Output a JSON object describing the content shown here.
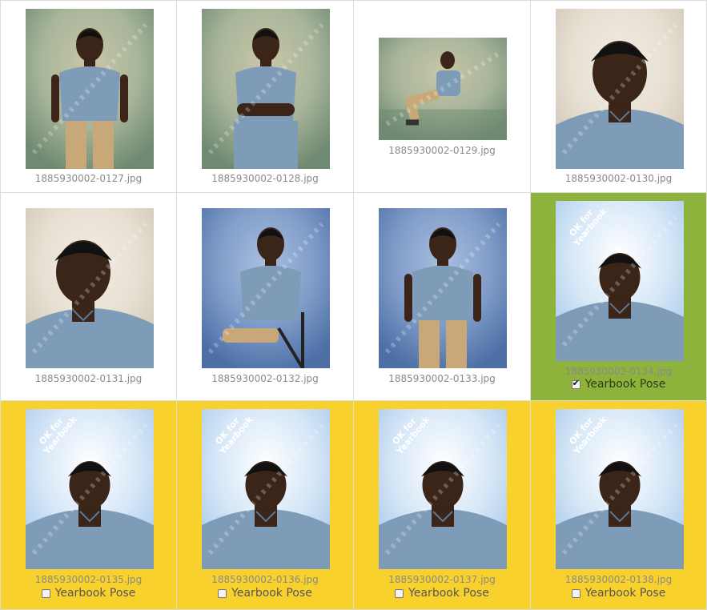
{
  "colors": {
    "approved_bg": "#8db33c",
    "candidate_bg": "#f8d12c",
    "border": "#dcdcdc"
  },
  "stamp_text_line1": "OK for",
  "stamp_text_line2": "Yearbook",
  "photos": [
    {
      "filename": "1885930002-0127.jpg",
      "bg": "mottled-green",
      "pose": "standing-full",
      "state": "none"
    },
    {
      "filename": "1885930002-0128.jpg",
      "bg": "mottled-green",
      "pose": "arms-crossed",
      "state": "none"
    },
    {
      "filename": "1885930002-0129.jpg",
      "bg": "mottled-green",
      "pose": "seated-floor",
      "state": "none"
    },
    {
      "filename": "1885930002-0130.jpg",
      "bg": "beige",
      "pose": "close-head",
      "state": "none"
    },
    {
      "filename": "1885930002-0131.jpg",
      "bg": "beige",
      "pose": "close-tilt",
      "state": "none"
    },
    {
      "filename": "1885930002-0132.jpg",
      "bg": "blue",
      "pose": "seated-chair",
      "state": "none"
    },
    {
      "filename": "1885930002-0133.jpg",
      "bg": "blue",
      "pose": "standing-lean",
      "state": "none"
    },
    {
      "filename": "1885930002-0134.jpg",
      "bg": "lightblue",
      "pose": "headshot",
      "state": "selected",
      "checkbox_label": "Yearbook Pose",
      "checked": true
    },
    {
      "filename": "1885930002-0135.jpg",
      "bg": "lightblue",
      "pose": "headshot",
      "state": "candidate",
      "checkbox_label": "Yearbook Pose",
      "checked": false
    },
    {
      "filename": "1885930002-0136.jpg",
      "bg": "lightblue",
      "pose": "headshot",
      "state": "candidate",
      "checkbox_label": "Yearbook Pose",
      "checked": false
    },
    {
      "filename": "1885930002-0137.jpg",
      "bg": "lightblue",
      "pose": "headshot",
      "state": "candidate",
      "checkbox_label": "Yearbook Pose",
      "checked": false
    },
    {
      "filename": "1885930002-0138.jpg",
      "bg": "lightblue",
      "pose": "headshot",
      "state": "candidate",
      "checkbox_label": "Yearbook Pose",
      "checked": false
    }
  ]
}
